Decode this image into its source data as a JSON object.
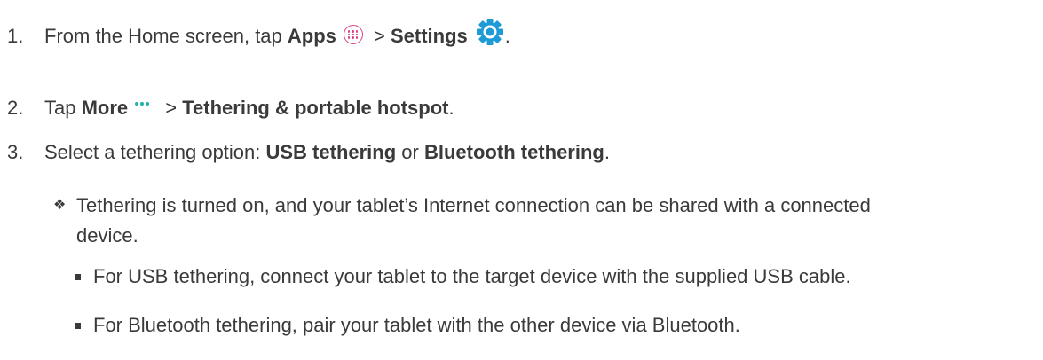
{
  "steps": [
    {
      "num": "1.",
      "part1": "From the Home screen, tap ",
      "bold1": "Apps",
      "sep": " > ",
      "bold2": "Settings",
      "end": "."
    },
    {
      "num": "2.",
      "part1": "Tap ",
      "bold1": "More",
      "sep": " > ",
      "bold2": "Tethering & portable hotspot",
      "end": "."
    },
    {
      "num": "3.",
      "part1": "Select a tethering option: ",
      "bold1": "USB tethering",
      "sep": " or ",
      "bold2": "Bluetooth tethering",
      "end": "."
    }
  ],
  "result": {
    "bullet": "❖",
    "line1": "Tethering is turned on, and your tablet’s Internet connection can be shared with a connected",
    "line2": "device."
  },
  "subitems": [
    "For USB tethering, connect your tablet to the target device with the supplied USB cable.",
    "For Bluetooth tethering, pair your tablet with the other device via Bluetooth."
  ],
  "icons": {
    "apps": "apps-icon",
    "settings": "gear-icon",
    "more": "more-dots-icon"
  },
  "colors": {
    "text": "#3a3a3a",
    "apps_icon": "#d9418c",
    "more_icon": "#1fb5a8",
    "gear_icon": "#1e9bd7"
  }
}
